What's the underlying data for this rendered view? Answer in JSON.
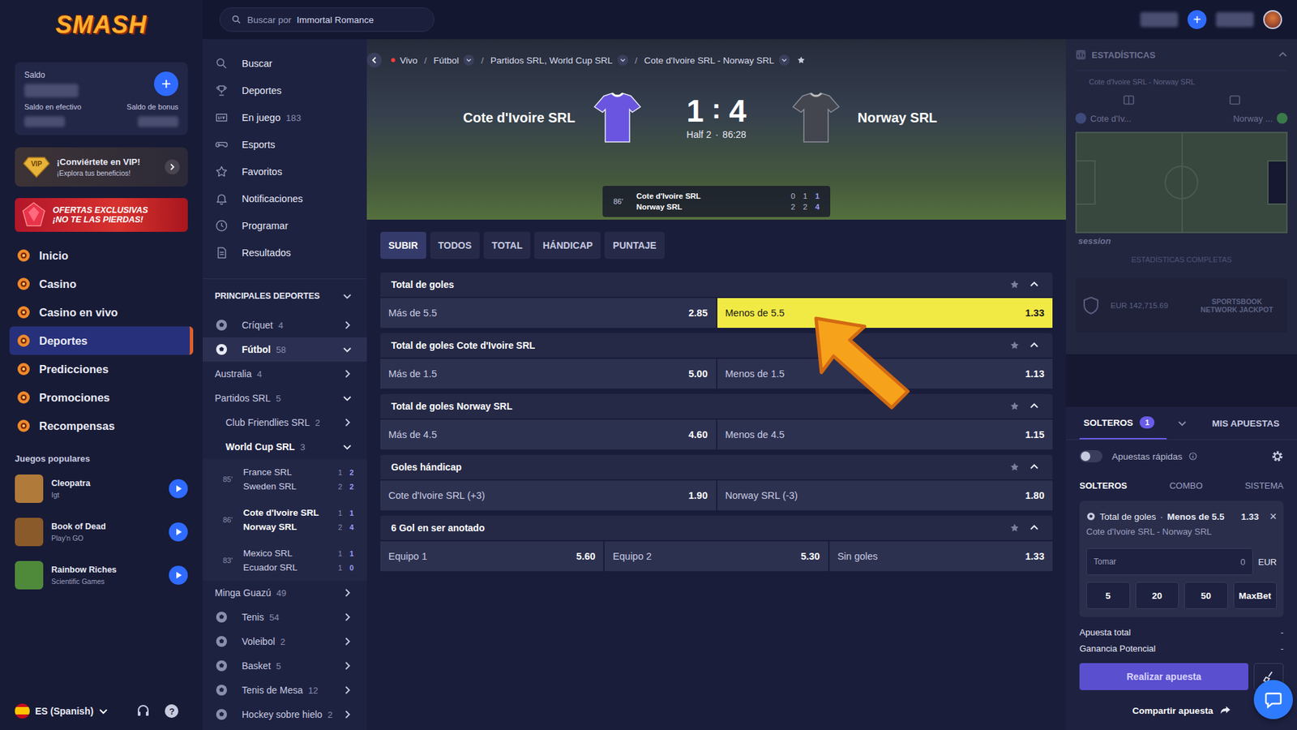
{
  "logo": "SMASH",
  "search": {
    "prefix": "Buscar por",
    "query": "Immortal Romance"
  },
  "topbar": {
    "add_button": "+"
  },
  "balance": {
    "title": "Saldo",
    "add_button": "+",
    "cash_label": "Saldo en efectivo",
    "bonus_label": "Saldo de bonus"
  },
  "vip": {
    "badge": "VIP",
    "title": "¡Conviértete en VIP!",
    "subtitle": "¡Explora tus beneficios!"
  },
  "promo_banner": {
    "line1": "OFERTAS EXCLUSIVAS",
    "line2": "¡NO TE LAS PIERDAS!"
  },
  "nav": [
    {
      "label": "Inicio",
      "selected": false
    },
    {
      "label": "Casino",
      "selected": false
    },
    {
      "label": "Casino en vivo",
      "selected": false
    },
    {
      "label": "Deportes",
      "selected": true
    },
    {
      "label": "Predicciones",
      "selected": false
    },
    {
      "label": "Promociones",
      "selected": false
    },
    {
      "label": "Recompensas",
      "selected": false
    }
  ],
  "popular_games": {
    "title": "Juegos populares",
    "items": [
      {
        "name": "Cleopatra",
        "provider": "Igt",
        "color": "#b07a3a"
      },
      {
        "name": "Book of Dead",
        "provider": "Play'n GO",
        "color": "#8a5a2a"
      },
      {
        "name": "Rainbow Riches",
        "provider": "Scientific Games",
        "color": "#4f8a3a"
      }
    ]
  },
  "footer": {
    "language": "ES (Spanish)",
    "help": "?"
  },
  "menu": [
    {
      "label": "Buscar",
      "count": ""
    },
    {
      "label": "Deportes",
      "count": ""
    },
    {
      "label": "En juego",
      "count": "183"
    },
    {
      "label": "Esports",
      "count": ""
    },
    {
      "label": "Favoritos",
      "count": ""
    },
    {
      "label": "Notificaciones",
      "count": ""
    },
    {
      "label": "Programar",
      "count": ""
    },
    {
      "label": "Resultados",
      "count": ""
    }
  ],
  "sports_header": {
    "label": "PRINCIPALES DEPORTES",
    "expanded": true
  },
  "sports": [
    {
      "kind": "sport",
      "name": "Críquet",
      "count": "4",
      "expanded": false,
      "selected": false
    },
    {
      "kind": "sport",
      "name": "Fútbol",
      "count": "58",
      "expanded": true,
      "selected": true
    },
    {
      "kind": "region",
      "name": "Australia",
      "count": "4",
      "expanded": false,
      "selected": false
    },
    {
      "kind": "region",
      "name": "Partidos SRL",
      "count": "5",
      "expanded": true,
      "selected": false
    },
    {
      "kind": "league",
      "name": "Club Friendlies SRL",
      "count": "2",
      "expanded": false,
      "selected": false
    },
    {
      "kind": "league",
      "name": "World Cup SRL",
      "count": "3",
      "expanded": true,
      "selected": true
    },
    {
      "kind": "match",
      "minute": "85'",
      "selected": false,
      "teams": [
        {
          "name": "France SRL",
          "scores": [
            "1",
            "2"
          ]
        },
        {
          "name": "Sweden SRL",
          "scores": [
            "2",
            "2"
          ]
        }
      ]
    },
    {
      "kind": "match",
      "minute": "86'",
      "selected": true,
      "teams": [
        {
          "name": "Cote d'Ivoire SRL",
          "scores": [
            "1",
            "1"
          ]
        },
        {
          "name": "Norway SRL",
          "scores": [
            "2",
            "4"
          ]
        }
      ]
    },
    {
      "kind": "match",
      "minute": "83'",
      "selected": false,
      "teams": [
        {
          "name": "Mexico SRL",
          "scores": [
            "1",
            "1"
          ]
        },
        {
          "name": "Ecuador SRL",
          "scores": [
            "1",
            "0"
          ]
        }
      ]
    },
    {
      "kind": "region",
      "name": "Minga Guazú",
      "count": "49",
      "expanded": false,
      "selected": false
    },
    {
      "kind": "sport",
      "name": "Tenis",
      "count": "54",
      "expanded": false,
      "selected": false
    },
    {
      "kind": "sport",
      "name": "Voleibol",
      "count": "2",
      "expanded": false,
      "selected": false
    },
    {
      "kind": "sport",
      "name": "Basket",
      "count": "5",
      "expanded": false,
      "selected": false
    },
    {
      "kind": "sport",
      "name": "Tenis de Mesa",
      "count": "12",
      "expanded": false,
      "selected": false
    },
    {
      "kind": "sport",
      "name": "Hockey sobre hielo",
      "count": "2",
      "expanded": false,
      "selected": false
    }
  ],
  "breadcrumb": {
    "separator": "/",
    "items": [
      {
        "label": "Vivo",
        "live": true,
        "dropdown": false
      },
      {
        "label": "Fútbol",
        "live": false,
        "dropdown": true
      },
      {
        "label": "Partidos SRL, World Cup SRL",
        "live": false,
        "dropdown": true
      },
      {
        "label": "Cote d'Ivoire SRL - Norway SRL",
        "live": false,
        "dropdown": true
      }
    ]
  },
  "scoreboard": {
    "home": "Cote d'Ivoire SRL",
    "away": "Norway SRL",
    "home_score": "1",
    "separator": ":",
    "away_score": "4",
    "period": "Half 2",
    "dot": "·",
    "clock": "86:28",
    "mini": {
      "minute": "86'",
      "rows": [
        {
          "team": "Cote d'Ivoire SRL",
          "scores": [
            "0",
            "1",
            "1"
          ]
        },
        {
          "team": "Norway SRL",
          "scores": [
            "2",
            "2",
            "4"
          ]
        }
      ]
    }
  },
  "market_tabs": [
    {
      "label": "SUBIR",
      "selected": true
    },
    {
      "label": "TODOS",
      "selected": false
    },
    {
      "label": "TOTAL",
      "selected": false
    },
    {
      "label": "HÁNDICAP",
      "selected": false
    },
    {
      "label": "PUNTAJE",
      "selected": false
    }
  ],
  "markets": [
    {
      "title": "Total de goles",
      "expanded": true,
      "outcomes": [
        {
          "label": "Más de 5.5",
          "odds": "2.85",
          "selected": false
        },
        {
          "label": "Menos de 5.5",
          "odds": "1.33",
          "selected": true
        }
      ]
    },
    {
      "title": "Total de goles Cote d'Ivoire SRL",
      "expanded": true,
      "outcomes": [
        {
          "label": "Más de 1.5",
          "odds": "5.00",
          "selected": false
        },
        {
          "label": "Menos de 1.5",
          "odds": "1.13",
          "selected": false
        }
      ]
    },
    {
      "title": "Total de goles Norway SRL",
      "expanded": true,
      "outcomes": [
        {
          "label": "Más de 4.5",
          "odds": "4.60",
          "selected": false
        },
        {
          "label": "Menos de 4.5",
          "odds": "1.15",
          "selected": false
        }
      ]
    },
    {
      "title": "Goles hándicap",
      "expanded": true,
      "outcomes": [
        {
          "label": "Cote d'Ivoire SRL (+3)",
          "odds": "1.90",
          "selected": false
        },
        {
          "label": "Norway SRL (-3)",
          "odds": "1.80",
          "selected": false
        }
      ]
    },
    {
      "title": "6 Gol en ser anotado",
      "expanded": true,
      "outcomes": [
        {
          "label": "Equipo 1",
          "odds": "5.60",
          "selected": false
        },
        {
          "label": "Equipo 2",
          "odds": "5.30",
          "selected": false
        },
        {
          "label": "Sin goles",
          "odds": "1.33",
          "selected": false
        }
      ]
    }
  ],
  "stats": {
    "title": "ESTADÍSTICAS",
    "match": "Cote d'Ivoire SRL - Norway SRL",
    "home": "Cote d'Iv...",
    "away": "Norway ...",
    "brand": "session",
    "full_link": "ESTADÍSTICAS COMPLETAS",
    "jackpot_amount": "EUR 142,715.69",
    "jackpot_label": "SPORTSBOOK NETWORK JACKPOT"
  },
  "betslip": {
    "tabs": [
      {
        "label": "SOLTEROS",
        "badge": "1",
        "selected": true
      },
      {
        "label": "MIS APUESTAS",
        "badge": "",
        "selected": false
      }
    ],
    "quick_bets": {
      "label": "Apuestas rápidas",
      "on": false
    },
    "modes": [
      {
        "label": "SOLTEROS",
        "selected": true
      },
      {
        "label": "COMBO",
        "selected": false
      },
      {
        "label": "SISTEMA",
        "selected": false
      }
    ],
    "bet": {
      "market": "Total de goles",
      "dot": "·",
      "selection": "Menos de 5.5",
      "odds": "1.33",
      "match": "Cote d'Ivoire SRL - Norway SRL",
      "close": "×"
    },
    "stake": {
      "label": "Tomar",
      "value": "0",
      "currency": "EUR"
    },
    "quick_amounts": [
      "5",
      "20",
      "50",
      "MaxBet"
    ],
    "summary": [
      {
        "label": "Apuesta total",
        "value": "-"
      },
      {
        "label": "Ganancia Potencial",
        "value": "-"
      }
    ],
    "place_button": "Realizar apuesta",
    "share": "Compartir apuesta"
  }
}
